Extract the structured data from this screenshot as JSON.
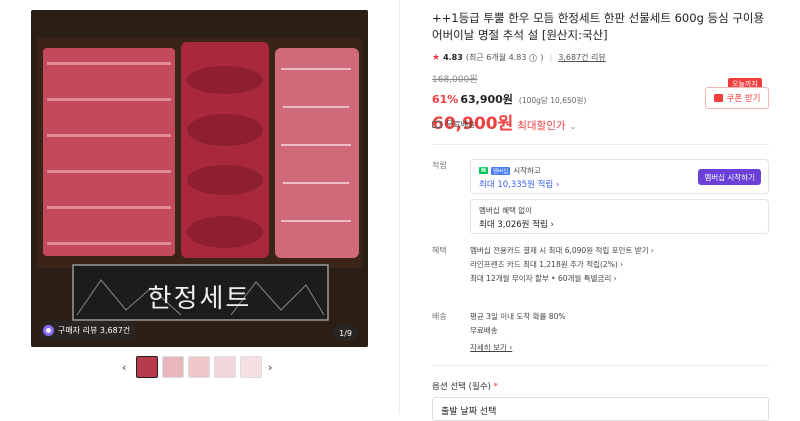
{
  "gallery": {
    "center_label": "한정세트",
    "review_pill": "구매자 리뷰 3,687건",
    "page_counter": "1/9"
  },
  "product": {
    "title": "++1등급 투뿔 한우 모듬 한정세트 한판 선물세트 600g 등심 구이용 어버이날 명절 추석 설 [원산지:국산]",
    "rating": "4.83",
    "rating_recent": "(최근 6개월 4.83",
    "rating_recent_close": ")",
    "review_count": "3,687건 리뷰",
    "original_price": "168,000원",
    "discount_rate": "61%",
    "sale_price": "63,900원",
    "unit_price": "(100g당 10,650원)",
    "max_discount_price": "60,900원",
    "max_discount_label": "최대할인가",
    "coupon_badge": "오늘까지",
    "coupon_button": "쿠폰 받기",
    "free_shipping": "무료배송"
  },
  "points": {
    "label": "적립",
    "npay": "N",
    "plus": "멤버십",
    "start_text": "시작하고",
    "max_point": "최대 10,335원 적립",
    "member_button": "멤버십 시작하기",
    "no_benefit": "멤버십 혜택 없이",
    "max_point2": "최대 3,026원 적립"
  },
  "benefits": {
    "label": "혜택",
    "items": [
      "멤버십 전용카드 결제 시 최대 6,090원 적립 포인트 받기",
      "라인프렌즈 카드 최대 1,218원 추가 적립(2%)",
      "최대 12개월 무이자 할부 • 60개월 특별금리"
    ]
  },
  "delivery": {
    "label": "배송",
    "line1": "평균 3일 이내 도착 확률 80%",
    "line2": "무료배송",
    "more": "자세히 보기"
  },
  "option": {
    "label": "옵션 선택 (필수)",
    "required_mark": "*",
    "select_value": "출발 날짜 선택"
  }
}
